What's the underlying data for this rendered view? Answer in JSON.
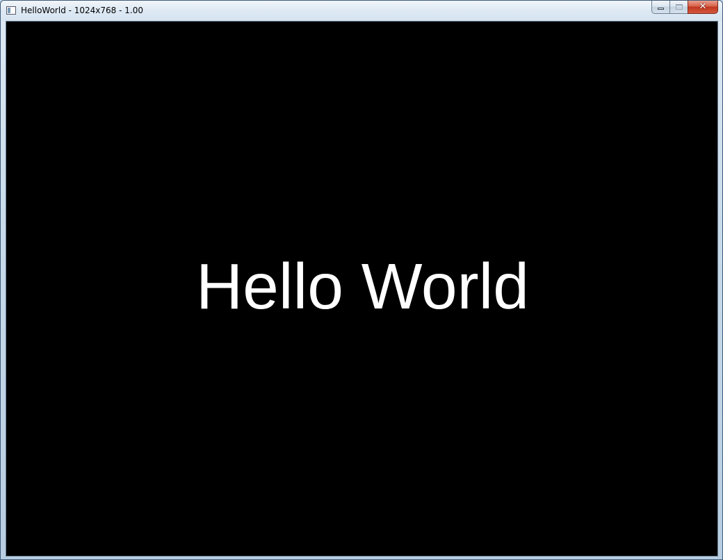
{
  "window": {
    "title": "HelloWorld - 1024x768 - 1.00",
    "controls": {
      "minimize": "",
      "maximize": "",
      "close": "✕"
    }
  },
  "content": {
    "text": "Hello World",
    "background_color": "#000000",
    "text_color": "#ffffff"
  }
}
